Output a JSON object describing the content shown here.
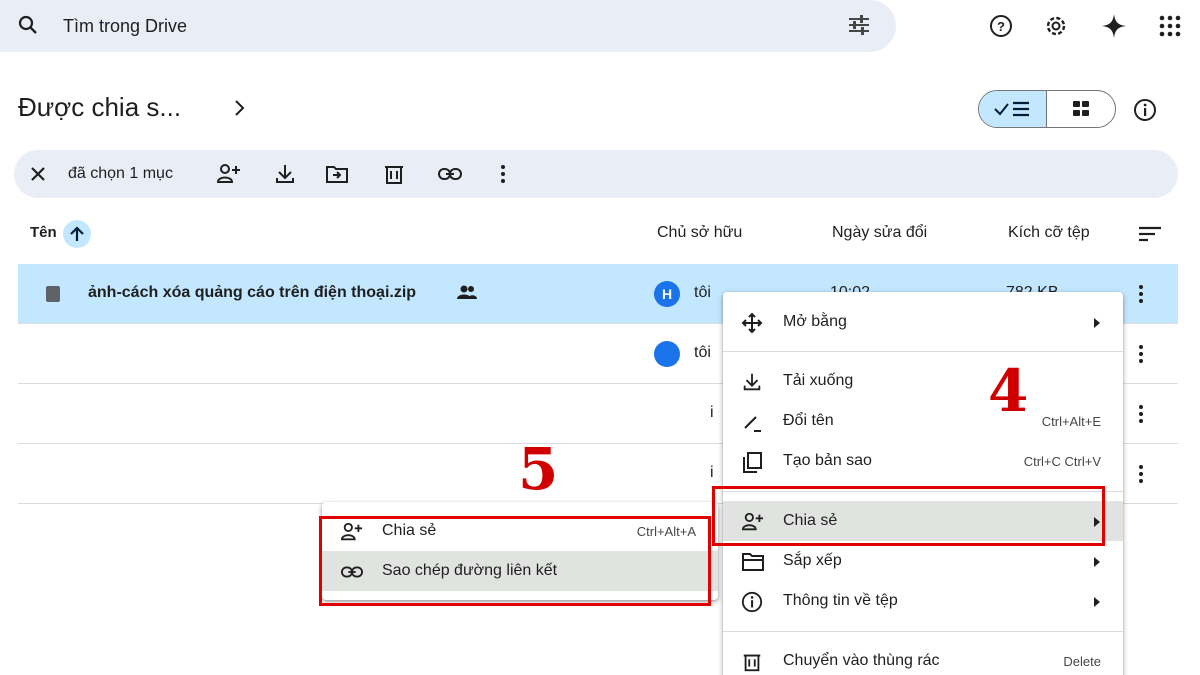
{
  "search": {
    "placeholder": "Tìm trong Drive"
  },
  "top_icons": [
    "search-icon",
    "filter-icon",
    "help-icon",
    "settings-icon",
    "gemini-icon",
    "apps-icon"
  ],
  "breadcrumb": {
    "title": "Được chia s..."
  },
  "selection": {
    "label": "đã chọn 1 mục"
  },
  "columns": {
    "name": "Tên",
    "owner": "Chủ sở hữu",
    "modified": "Ngày sửa đổi",
    "size": "Kích cỡ tệp"
  },
  "rows": [
    {
      "name": "ảnh-cách xóa quảng cáo trên điện thoại.zip",
      "avatar": "H",
      "owner": "tôi",
      "date": "10:02",
      "size": "782 KB"
    },
    {
      "owner": "tôi"
    },
    {
      "owner": "i"
    },
    {
      "owner": "i"
    }
  ],
  "context_menu": {
    "items": [
      {
        "label": "Mở bằng"
      },
      {
        "label": "Tải xuống"
      },
      {
        "label": "Đổi tên",
        "shortcut": "Ctrl+Alt+E"
      },
      {
        "label": "Tạo bản sao",
        "shortcut": "Ctrl+C Ctrl+V"
      },
      {
        "label": "Chia sẻ"
      },
      {
        "label": "Sắp xếp"
      },
      {
        "label": "Thông tin về tệp"
      },
      {
        "label": "Chuyển vào thùng rác",
        "shortcut": "Delete"
      }
    ]
  },
  "submenu": {
    "items": [
      {
        "label": "Chia sẻ",
        "shortcut": "Ctrl+Alt+A"
      },
      {
        "label": "Sao chép đường liên kết"
      }
    ]
  },
  "annotations": {
    "step4": "4",
    "step5": "5",
    "color": "#e00000"
  }
}
